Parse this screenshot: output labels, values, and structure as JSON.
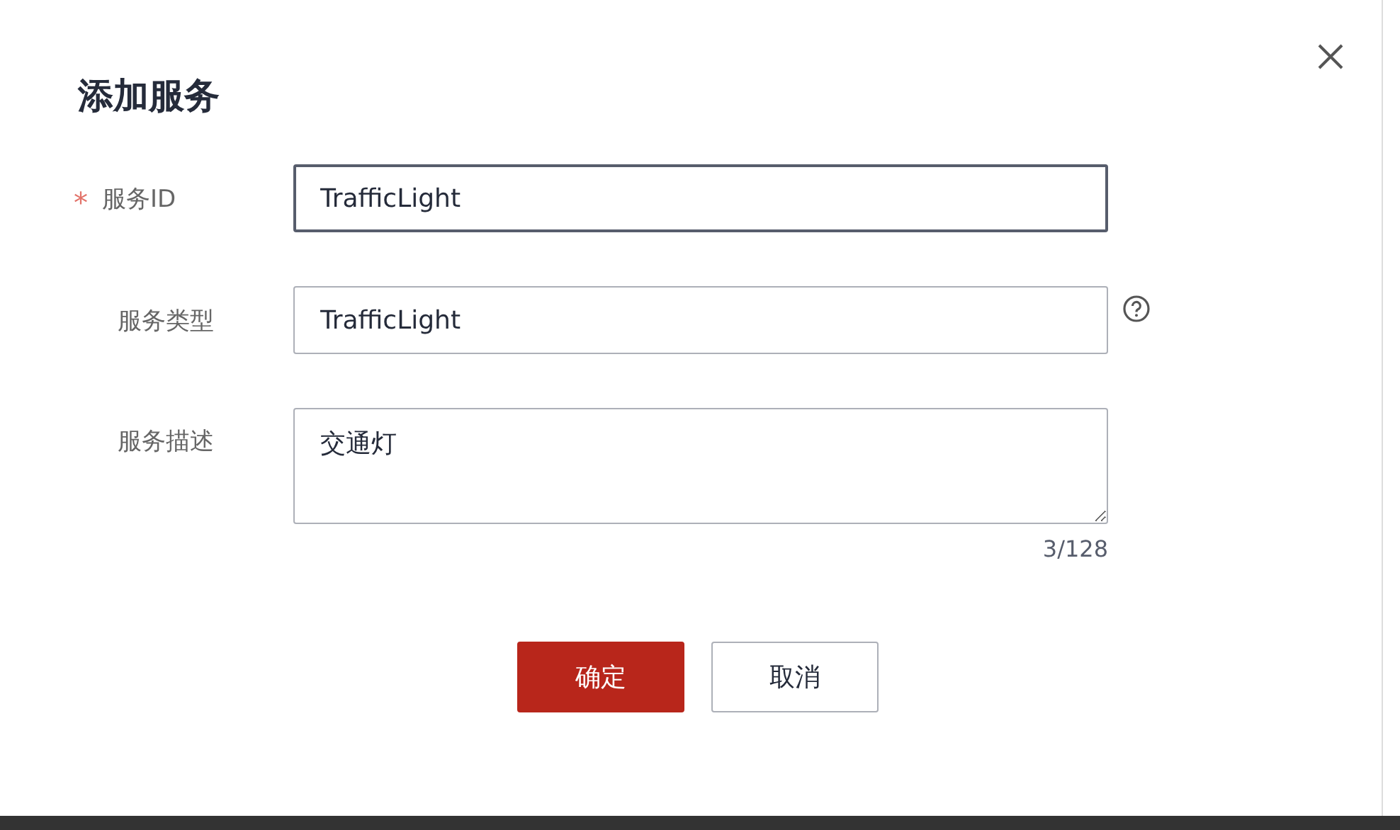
{
  "dialog": {
    "title": "添加服务"
  },
  "fields": [
    {
      "kind": "input",
      "label": "服务ID",
      "required_mark": "*",
      "value": "TrafficLight",
      "focused": true,
      "help": false
    },
    {
      "kind": "input",
      "label": "服务类型",
      "value": "TrafficLight",
      "focused": false,
      "help": true
    },
    {
      "kind": "textarea",
      "label": "服务描述",
      "value": "交通灯",
      "focused": false,
      "help": false,
      "counter": "3/128"
    }
  ],
  "buttons": [
    {
      "label": "确定",
      "kind": "primary"
    },
    {
      "label": "取消",
      "kind": "secondary"
    }
  ]
}
